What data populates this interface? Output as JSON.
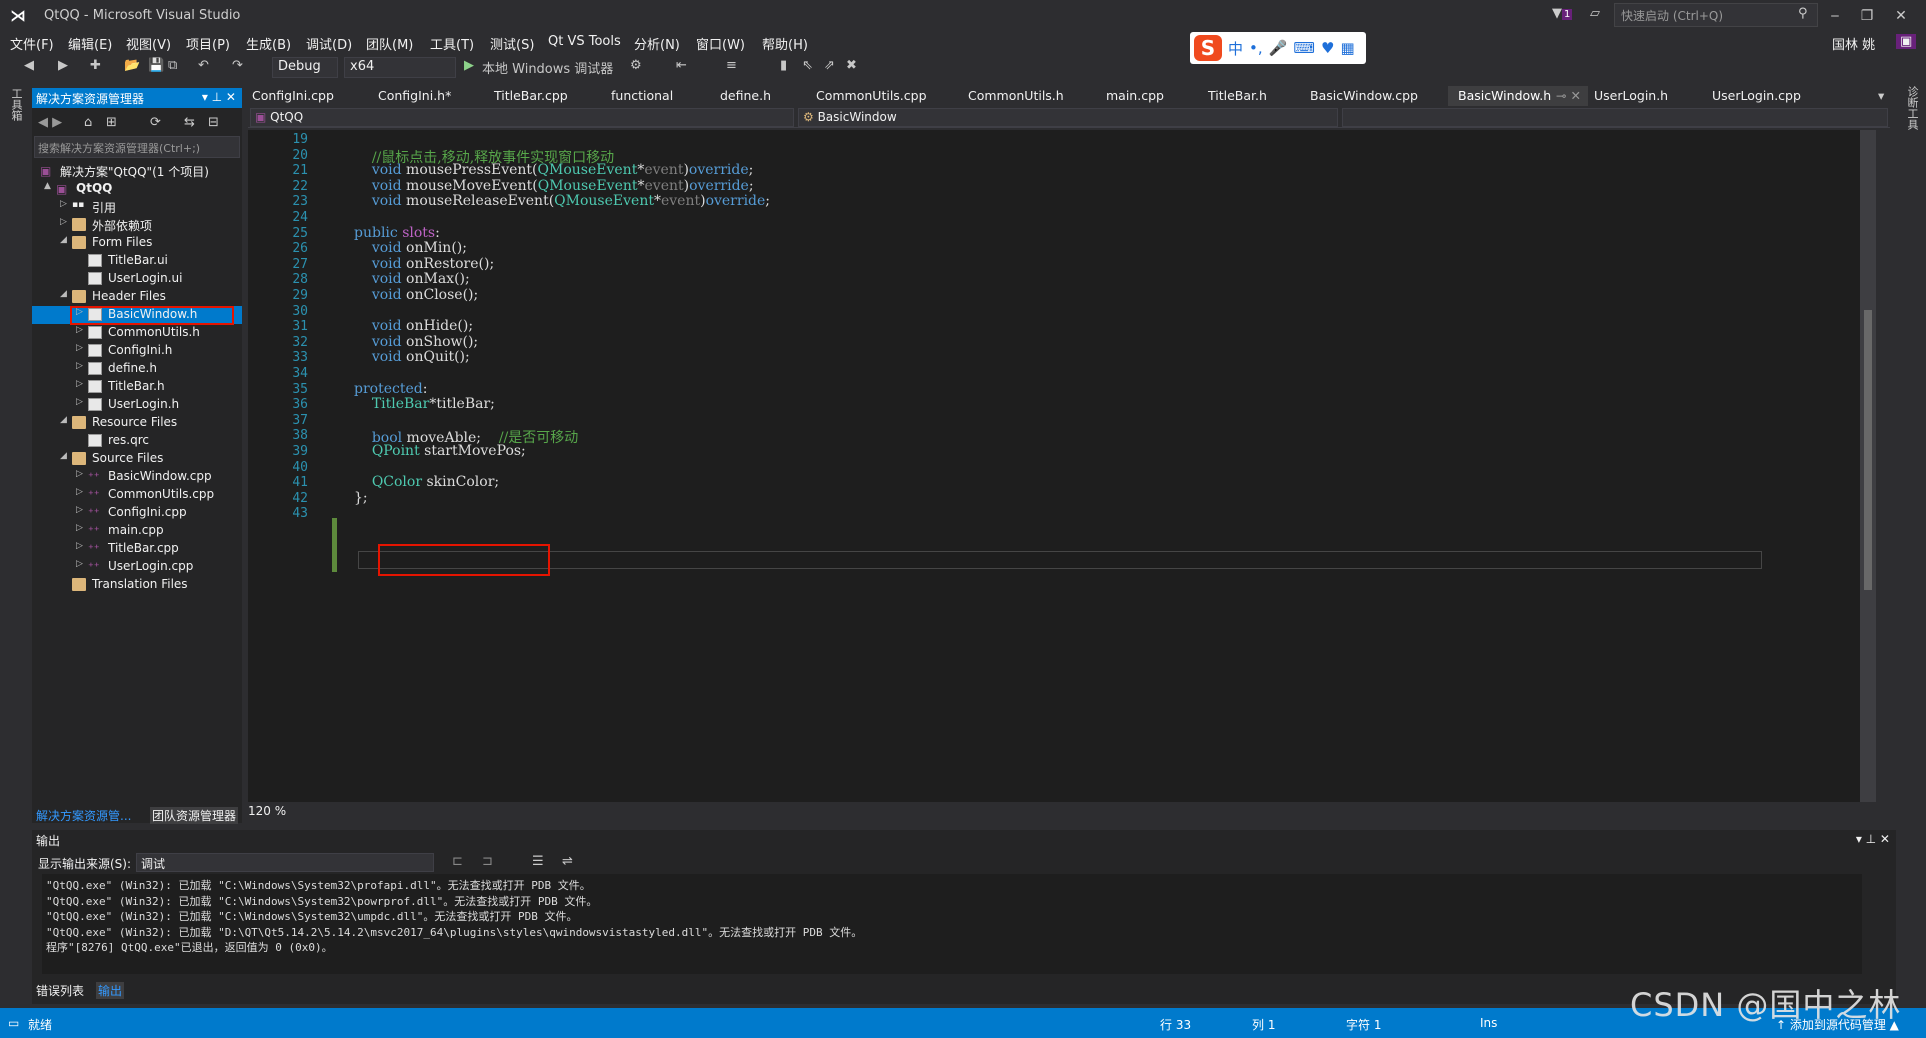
{
  "window": {
    "title": "QtQQ - Microsoft Visual Studio",
    "quick_launch": "快速启动 (Ctrl+Q)",
    "filter_badge": "1",
    "user": "国林 姚"
  },
  "menu": [
    "文件(F)",
    "编辑(E)",
    "视图(V)",
    "项目(P)",
    "生成(B)",
    "调试(D)",
    "团队(M)",
    "工具(T)",
    "测试(S)",
    "Qt VS Tools",
    "分析(N)",
    "窗口(W)",
    "帮助(H)"
  ],
  "toolbar": {
    "config": "Debug",
    "platform": "x64",
    "run_label": "本地 Windows 调试器"
  },
  "ime": {
    "lang": "中"
  },
  "solution_explorer": {
    "title": "解决方案资源管理器",
    "search_placeholder": "搜索解决方案资源管理器(Ctrl+;)",
    "tree": [
      {
        "label": "解决方案\"QtQQ\"(1 个项目)",
        "depth": 0,
        "kind": "solution",
        "arrow": ""
      },
      {
        "label": "QtQQ",
        "depth": 1,
        "kind": "project",
        "arrow": "▲"
      },
      {
        "label": "引用",
        "depth": 2,
        "kind": "ref",
        "arrow": "▷"
      },
      {
        "label": "外部依赖项",
        "depth": 2,
        "kind": "folder",
        "arrow": "▷"
      },
      {
        "label": "Form Files",
        "depth": 2,
        "kind": "folder",
        "arrow": "◢"
      },
      {
        "label": "TitleBar.ui",
        "depth": 3,
        "kind": "file",
        "arrow": ""
      },
      {
        "label": "UserLogin.ui",
        "depth": 3,
        "kind": "file",
        "arrow": ""
      },
      {
        "label": "Header Files",
        "depth": 2,
        "kind": "folder",
        "arrow": "◢"
      },
      {
        "label": "BasicWindow.h",
        "depth": 3,
        "kind": "file",
        "arrow": "▷",
        "selected": true
      },
      {
        "label": "CommonUtils.h",
        "depth": 3,
        "kind": "file",
        "arrow": "▷"
      },
      {
        "label": "ConfigIni.h",
        "depth": 3,
        "kind": "file",
        "arrow": "▷"
      },
      {
        "label": "define.h",
        "depth": 3,
        "kind": "file",
        "arrow": "▷"
      },
      {
        "label": "TitleBar.h",
        "depth": 3,
        "kind": "file",
        "arrow": "▷"
      },
      {
        "label": "UserLogin.h",
        "depth": 3,
        "kind": "file",
        "arrow": "▷"
      },
      {
        "label": "Resource Files",
        "depth": 2,
        "kind": "folder",
        "arrow": "◢"
      },
      {
        "label": "res.qrc",
        "depth": 3,
        "kind": "file",
        "arrow": ""
      },
      {
        "label": "Source Files",
        "depth": 2,
        "kind": "folder",
        "arrow": "◢"
      },
      {
        "label": "BasicWindow.cpp",
        "depth": 3,
        "kind": "cpp",
        "arrow": "▷"
      },
      {
        "label": "CommonUtils.cpp",
        "depth": 3,
        "kind": "cpp",
        "arrow": "▷"
      },
      {
        "label": "ConfigIni.cpp",
        "depth": 3,
        "kind": "cpp",
        "arrow": "▷"
      },
      {
        "label": "main.cpp",
        "depth": 3,
        "kind": "cpp",
        "arrow": "▷"
      },
      {
        "label": "TitleBar.cpp",
        "depth": 3,
        "kind": "cpp",
        "arrow": "▷"
      },
      {
        "label": "UserLogin.cpp",
        "depth": 3,
        "kind": "cpp",
        "arrow": "▷"
      },
      {
        "label": "Translation Files",
        "depth": 2,
        "kind": "folder",
        "arrow": ""
      }
    ],
    "bottom_tabs": [
      "解决方案资源管...",
      "团队资源管理器"
    ]
  },
  "side_tabs": {
    "left": "工具箱",
    "right": "诊断工具"
  },
  "editor": {
    "tabs": [
      "ConfigIni.cpp",
      "ConfigIni.h*",
      "TitleBar.cpp",
      "functional",
      "define.h",
      "CommonUtils.cpp",
      "CommonUtils.h",
      "main.cpp",
      "TitleBar.h",
      "BasicWindow.cpp",
      "BasicWindow.h",
      "UserLogin.h",
      "UserLogin.cpp"
    ],
    "active_tab": "BasicWindow.h",
    "nav_project": "QtQQ",
    "nav_class": "BasicWindow",
    "zoom": "120 %",
    "lines": [
      {
        "n": "19",
        "html": ""
      },
      {
        "n": "20",
        "html": "    <span class='cm'>//鼠标点击,移动,释放事件实现窗口移动</span>"
      },
      {
        "n": "21",
        "html": "    <span class='kw'>void</span> mousePressEvent(<span class='ty'>QMouseEvent</span>*<span class='pm'>event</span>)<span class='kw'>override</span>;"
      },
      {
        "n": "22",
        "html": "    <span class='kw'>void</span> mouseMoveEvent(<span class='ty'>QMouseEvent</span>*<span class='pm'>event</span>)<span class='kw'>override</span>;"
      },
      {
        "n": "23",
        "html": "    <span class='kw'>void</span> mouseReleaseEvent(<span class='ty'>QMouseEvent</span>*<span class='pm'>event</span>)<span class='kw'>override</span>;"
      },
      {
        "n": "24",
        "html": ""
      },
      {
        "n": "25",
        "html": "<span class='kw'>public</span> <span class='mc'>slots</span>:"
      },
      {
        "n": "26",
        "html": "    <span class='kw'>void</span> onMin();"
      },
      {
        "n": "27",
        "html": "    <span class='kw'>void</span> onRestore();"
      },
      {
        "n": "28",
        "html": "    <span class='kw'>void</span> onMax();"
      },
      {
        "n": "29",
        "html": "    <span class='kw'>void</span> onClose();"
      },
      {
        "n": "30",
        "html": ""
      },
      {
        "n": "31",
        "html": "    <span class='kw'>void</span> onHide();"
      },
      {
        "n": "32",
        "html": "    <span class='kw'>void</span> onShow();"
      },
      {
        "n": "33",
        "html": "    <span class='kw'>void</span> onQuit();"
      },
      {
        "n": "34",
        "html": ""
      },
      {
        "n": "35",
        "html": "<span class='kw'>protected</span>:"
      },
      {
        "n": "36",
        "html": "    <span class='ty'>TitleBar</span>*titleBar;"
      },
      {
        "n": "37",
        "html": ""
      },
      {
        "n": "38",
        "html": "    <span class='kw'>bool</span> moveAble;    <span class='cm'>//是否可移动</span>"
      },
      {
        "n": "39",
        "html": "    <span class='ty'>QPoint</span> startMovePos;"
      },
      {
        "n": "40",
        "html": ""
      },
      {
        "n": "41",
        "html": "    <span class='ty'>QColor</span> skinColor;"
      },
      {
        "n": "42",
        "html": "};"
      },
      {
        "n": "43",
        "html": ""
      }
    ]
  },
  "output": {
    "title": "输出",
    "source_label": "显示输出来源(S):",
    "source_value": "调试",
    "lines": [
      "\"QtQQ.exe\" (Win32): 已加载 \"C:\\Windows\\System32\\profapi.dll\"。无法查找或打开 PDB 文件。",
      "\"QtQQ.exe\" (Win32): 已加载 \"C:\\Windows\\System32\\powrprof.dll\"。无法查找或打开 PDB 文件。",
      "\"QtQQ.exe\" (Win32): 已加载 \"C:\\Windows\\System32\\umpdc.dll\"。无法查找或打开 PDB 文件。",
      "\"QtQQ.exe\" (Win32): 已加载 \"D:\\QT\\Qt5.14.2\\5.14.2\\msvc2017_64\\plugins\\styles\\qwindowsvistastyled.dll\"。无法查找或打开 PDB 文件。",
      "程序\"[8276] QtQQ.exe\"已退出，返回值为 0 (0x0)。"
    ],
    "bottom_tabs": [
      "错误列表",
      "输出"
    ]
  },
  "status": {
    "ready": "就绪",
    "row": "行 33",
    "col": "列 1",
    "char": "字符 1",
    "ins": "Ins",
    "source_control": "↑ 添加到源代码管理 ▲"
  },
  "watermark": "CSDN @国中之林"
}
